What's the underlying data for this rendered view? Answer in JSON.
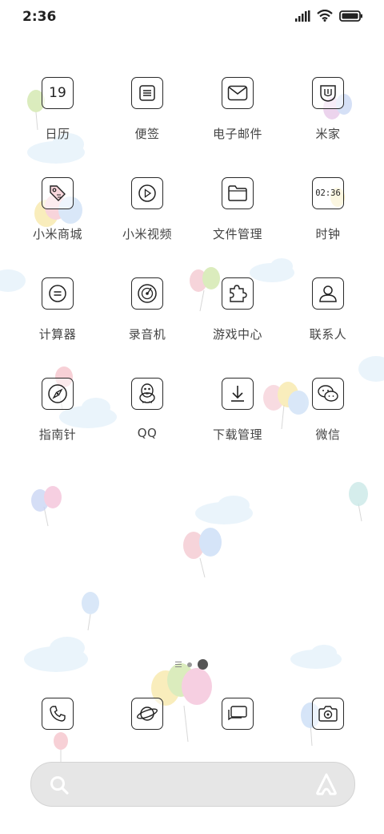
{
  "status": {
    "time": "2:36"
  },
  "apps": [
    {
      "label": "日历",
      "icon": "calendar-icon",
      "badge": "19"
    },
    {
      "label": "便签",
      "icon": "notes-icon"
    },
    {
      "label": "电子邮件",
      "icon": "mail-icon"
    },
    {
      "label": "米家",
      "icon": "mijia-icon"
    },
    {
      "label": "小米商城",
      "icon": "shop-tag-icon"
    },
    {
      "label": "小米视频",
      "icon": "video-play-icon"
    },
    {
      "label": "文件管理",
      "icon": "folder-icon"
    },
    {
      "label": "时钟",
      "icon": "clock-icon",
      "badge": "02:36"
    },
    {
      "label": "计算器",
      "icon": "calculator-icon"
    },
    {
      "label": "录音机",
      "icon": "recorder-icon"
    },
    {
      "label": "游戏中心",
      "icon": "puzzle-icon"
    },
    {
      "label": "联系人",
      "icon": "contact-icon"
    },
    {
      "label": "指南针",
      "icon": "compass-icon"
    },
    {
      "label": "QQ",
      "icon": "qq-penguin-icon"
    },
    {
      "label": "下载管理",
      "icon": "download-icon"
    },
    {
      "label": "微信",
      "icon": "wechat-icon"
    }
  ],
  "dock": [
    {
      "icon": "phone-icon"
    },
    {
      "icon": "browser-planet-icon"
    },
    {
      "icon": "messages-icon"
    },
    {
      "icon": "camera-icon"
    }
  ],
  "search": {
    "icon": "search-icon",
    "assistant_icon": "assistant-icon"
  }
}
